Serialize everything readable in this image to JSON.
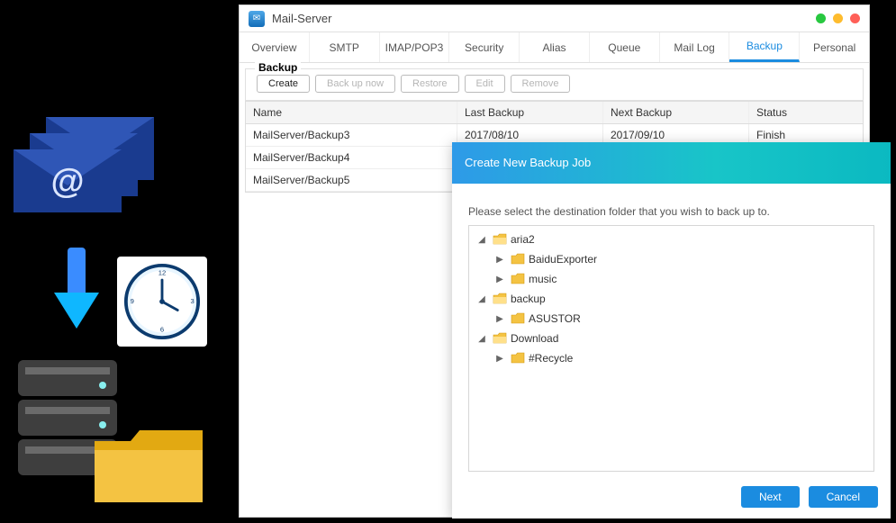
{
  "window": {
    "title": "Mail-Server"
  },
  "tabs": [
    {
      "label": "Overview"
    },
    {
      "label": "SMTP"
    },
    {
      "label": "IMAP/POP3"
    },
    {
      "label": "Security"
    },
    {
      "label": "Alias"
    },
    {
      "label": "Queue"
    },
    {
      "label": "Mail Log"
    },
    {
      "label": "Backup",
      "active": true
    },
    {
      "label": "Personal"
    }
  ],
  "section": {
    "legend": "Backup",
    "buttons": {
      "create": "Create",
      "backup_now": "Back up now",
      "restore": "Restore",
      "edit": "Edit",
      "remove": "Remove"
    }
  },
  "grid": {
    "headers": {
      "name": "Name",
      "last": "Last Backup",
      "next": "Next Backup",
      "status": "Status"
    },
    "rows": [
      {
        "name": "MailServer/Backup3",
        "last": "2017/08/10",
        "next": "2017/09/10",
        "status": "Finish"
      },
      {
        "name": "MailServer/Backup4",
        "last": "",
        "next": "",
        "status": ""
      },
      {
        "name": "MailServer/Backup5",
        "last": "",
        "next": "",
        "status": ""
      }
    ]
  },
  "dialog": {
    "title": "Create New Backup Job",
    "prompt": "Please select the destination folder that you wish to back up to.",
    "tree": [
      {
        "label": "aria2",
        "open": true,
        "depth": 0
      },
      {
        "label": "BaiduExporter",
        "open": false,
        "depth": 1
      },
      {
        "label": "music",
        "open": false,
        "depth": 1
      },
      {
        "label": "backup",
        "open": true,
        "depth": 0
      },
      {
        "label": "ASUSTOR",
        "open": false,
        "depth": 1
      },
      {
        "label": "Download",
        "open": true,
        "depth": 0
      },
      {
        "label": "#Recycle",
        "open": false,
        "depth": 1
      }
    ],
    "buttons": {
      "next": "Next",
      "cancel": "Cancel"
    }
  }
}
